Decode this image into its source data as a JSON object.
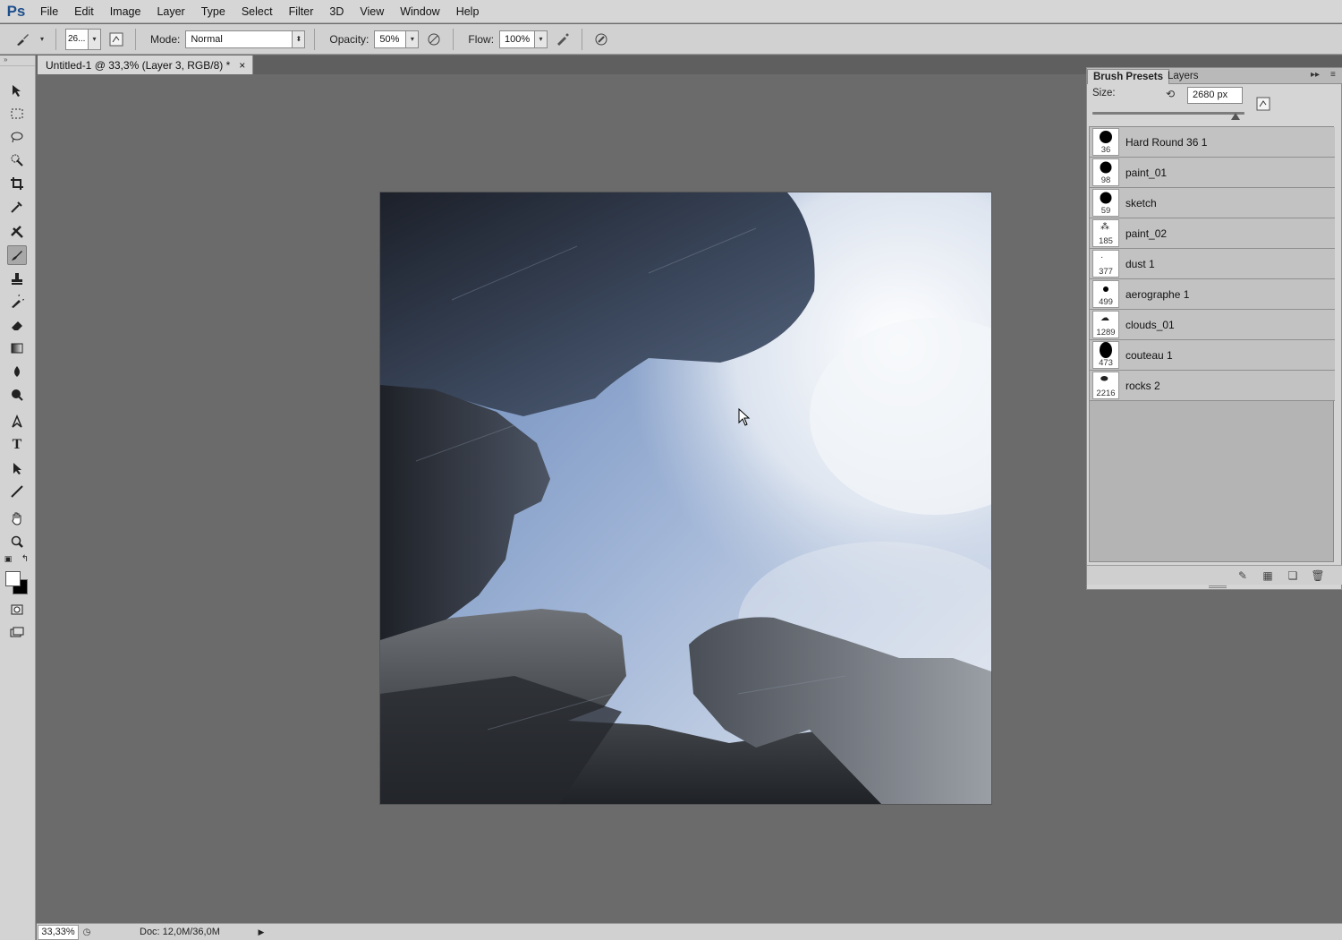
{
  "app": {
    "logo": "Ps"
  },
  "menu": [
    "File",
    "Edit",
    "Image",
    "Layer",
    "Type",
    "Select",
    "Filter",
    "3D",
    "View",
    "Window",
    "Help"
  ],
  "options": {
    "brush_size": "26...",
    "mode_label": "Mode:",
    "mode_value": "Normal",
    "opacity_label": "Opacity:",
    "opacity_value": "50%",
    "flow_label": "Flow:",
    "flow_value": "100%"
  },
  "document": {
    "tab_title": "Untitled-1 @ 33,3% (Layer 3, RGB/8) *",
    "close": "×"
  },
  "status": {
    "zoom": "33,33%",
    "doc_info": "Doc: 12,0M/36,0M"
  },
  "panel": {
    "tabs": [
      "Brush Presets",
      "Layers"
    ],
    "size_label": "Size:",
    "size_value": "2680 px",
    "size_fraction": 0.94,
    "brushes": [
      {
        "name": "Hard Round 36 1",
        "num": "36"
      },
      {
        "name": "paint_01",
        "num": "98"
      },
      {
        "name": "sketch",
        "num": "59"
      },
      {
        "name": "paint_02",
        "num": "185"
      },
      {
        "name": "dust 1",
        "num": "377"
      },
      {
        "name": "aerographe 1",
        "num": "499"
      },
      {
        "name": "clouds_01",
        "num": "1289"
      },
      {
        "name": "couteau 1",
        "num": "473"
      },
      {
        "name": "rocks 2",
        "num": "2216"
      }
    ]
  },
  "colors": {
    "foreground": "#ffffff",
    "background": "#000000",
    "sky": "#8ea6cc",
    "rock": "#2a2e35"
  }
}
